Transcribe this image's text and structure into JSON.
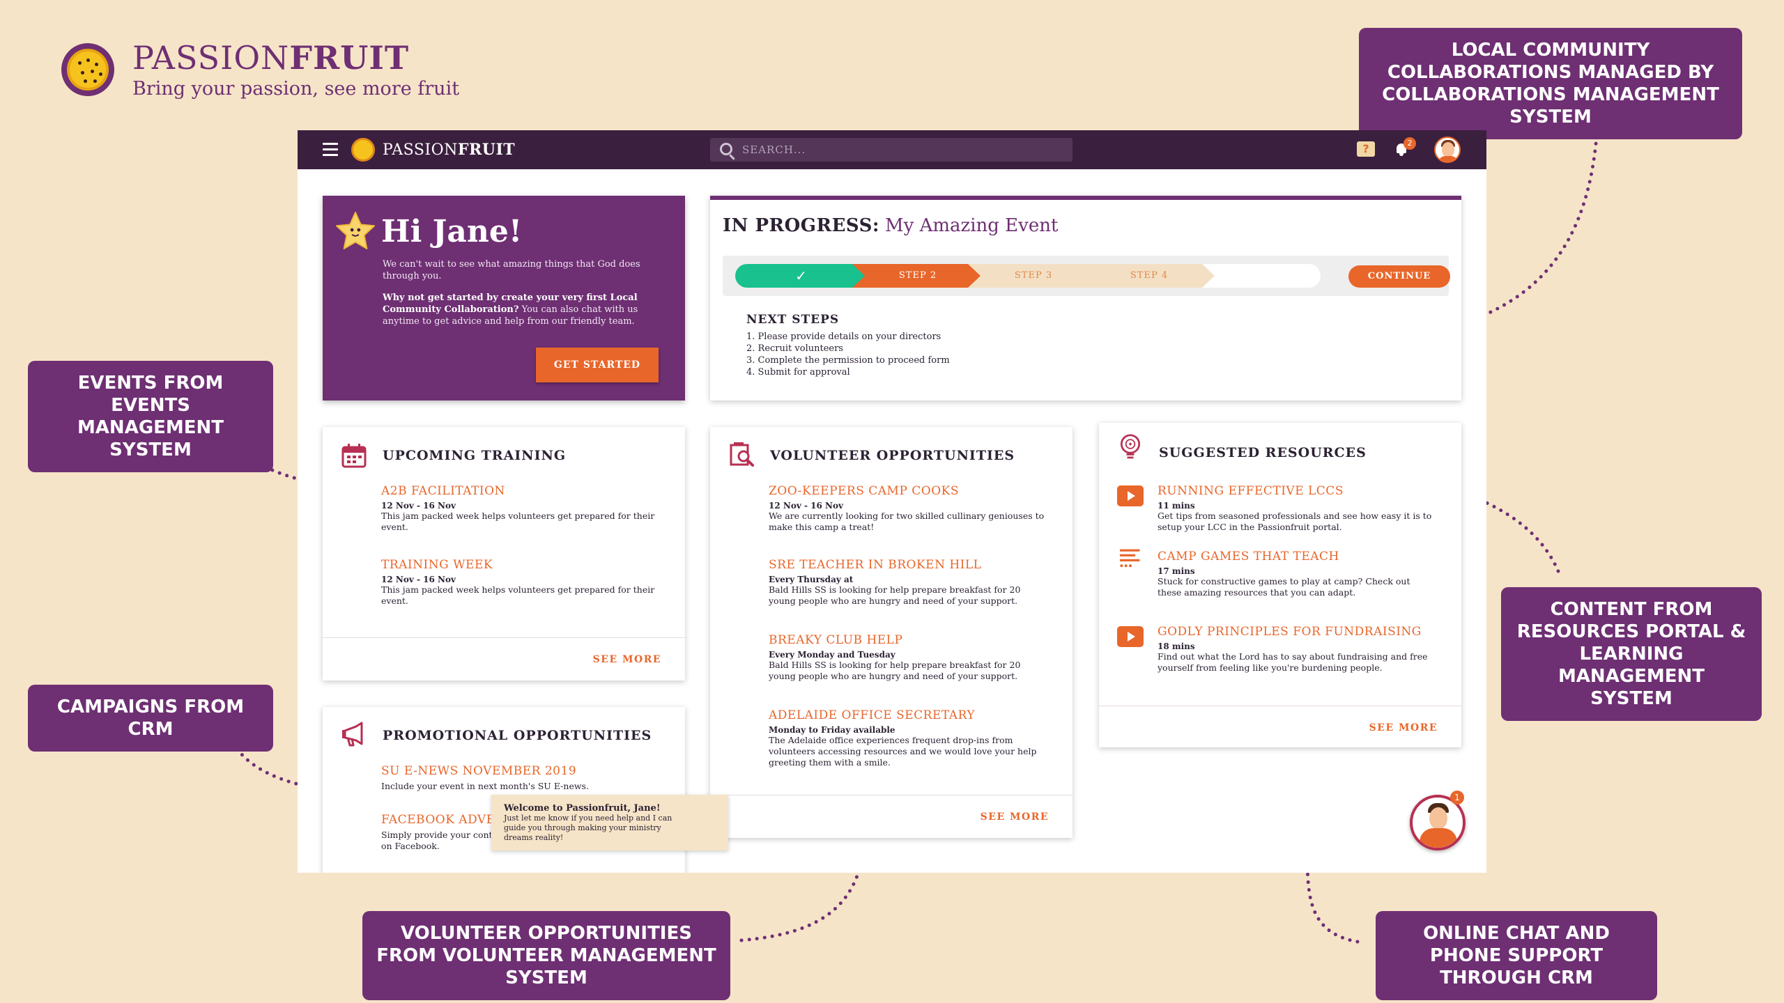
{
  "brand": {
    "name_light": "PASSION",
    "name_bold": "FRUIT",
    "tagline": "Bring your passion, see more fruit"
  },
  "callouts": {
    "collaborations": "LOCAL COMMUNITY COLLABORATIONS MANAGED BY COLLABORATIONS MANAGEMENT SYSTEM",
    "events": "EVENTS FROM EVENTS MANAGEMENT SYSTEM",
    "campaigns": "CAMPAIGNS FROM CRM",
    "resources": "CONTENT FROM RESOURCES PORTAL & LEARNING MANAGEMENT SYSTEM",
    "volunteers": "VOLUNTEER OPPORTUNITIES FROM VOLUNTEER MANAGEMENT SYSTEM",
    "chat": "ONLINE CHAT AND PHONE SUPPORT THROUGH CRM"
  },
  "topbar": {
    "brand_light": "PASSION",
    "brand_bold": "FRUIT",
    "search_placeholder": "SEARCH...",
    "help_icon": "?",
    "notification_count": "2"
  },
  "welcome": {
    "greeting": "Hi Jane!",
    "intro": "We can't wait to see what amazing things that God does through you.",
    "cta_bold": "Why not get started by create your very first Local Community Collaboration?",
    "cta_rest": " You can also chat with us anytime to get advice and help from our friendly team.",
    "button": "GET STARTED"
  },
  "progress": {
    "label": "IN PROGRESS:",
    "event_name": "My Amazing Event",
    "steps": [
      "STEP 2",
      "STEP 3",
      "STEP 4"
    ],
    "continue": "CONTINUE",
    "next_title": "NEXT STEPS",
    "next_steps": [
      "1. Please provide details on your directors",
      "2. Recruit volunteers",
      "3. Complete the permission to proceed form",
      "4. Submit for approval"
    ]
  },
  "training": {
    "title": "UPCOMING TRAINING",
    "items": [
      {
        "title": "A2B FACILITATION",
        "meta": "12 Nov - 16 Nov",
        "desc": "This jam packed week helps volunteers get prepared for their event."
      },
      {
        "title": "TRAINING WEEK",
        "meta": "12 Nov - 16 Nov",
        "desc": "This jam packed week helps volunteers get prepared for their event."
      }
    ],
    "see_more": "SEE MORE"
  },
  "promotional": {
    "title": "PROMOTIONAL OPPORTUNITIES",
    "items": [
      {
        "title": "SU E-NEWS NOVEMBER 2019",
        "desc": "Include your event in next month's SU E-news."
      },
      {
        "title": "FACEBOOK ADVERTISING",
        "desc": "Simply provide your content and we will promote your event on Facebook."
      }
    ]
  },
  "volunteer": {
    "title": "VOLUNTEER OPPORTUNITIES",
    "items": [
      {
        "title": "ZOO-KEEPERS CAMP COOKS",
        "meta": "12 Nov - 16 Nov",
        "desc": "We are currently looking for two skilled cullinary geniouses to make this camp a treat!"
      },
      {
        "title": "SRE TEACHER IN BROKEN HILL",
        "meta": "Every Thursday at",
        "desc": "Bald Hills SS is looking for help prepare breakfast for 20 young people who are hungry and need of your support."
      },
      {
        "title": "BREAKY CLUB HELP",
        "meta": "Every Monday and Tuesday",
        "desc": "Bald Hills SS is looking for help prepare breakfast for 20 young people who are hungry and need of your support."
      },
      {
        "title": "ADELAIDE OFFICE SECRETARY",
        "meta": "Monday to Friday available",
        "desc": "The Adelaide office experiences frequent drop-ins from volunteers accessing resources and we would love your help greeting them with a smile."
      }
    ],
    "see_more": "SEE MORE"
  },
  "resources": {
    "title": "SUGGESTED RESOURCES",
    "items": [
      {
        "title": "RUNNING EFFECTIVE LCCS",
        "meta": "11 mins",
        "desc": "Get tips from seasoned professionals and see how easy it is to setup your LCC in the Passionfruit portal.",
        "icon": "video-play-icon"
      },
      {
        "title": "CAMP GAMES THAT TEACH",
        "meta": "17 mins",
        "desc": "Stuck for constructive games to play at camp? Check out these amazing resources that you can adapt.",
        "icon": "article-icon"
      },
      {
        "title": "GODLY PRINCIPLES FOR FUNDRAISING",
        "meta": "18 mins",
        "desc": "Find out what the Lord has to say about fundraising and free yourself from feeling like you're burdening people.",
        "icon": "video-play-icon"
      }
    ],
    "see_more": "SEE MORE"
  },
  "chat": {
    "title": "Welcome to Passionfruit, Jane!",
    "message": "Just let me know if you need help and I can guide you through making your ministry dreams reality!",
    "badge": "1"
  },
  "colors": {
    "purple": "#6e2f73",
    "orange": "#e8662a",
    "green": "#18c18d",
    "background": "#f6e4c8",
    "topbar": "#3b1f3e"
  }
}
